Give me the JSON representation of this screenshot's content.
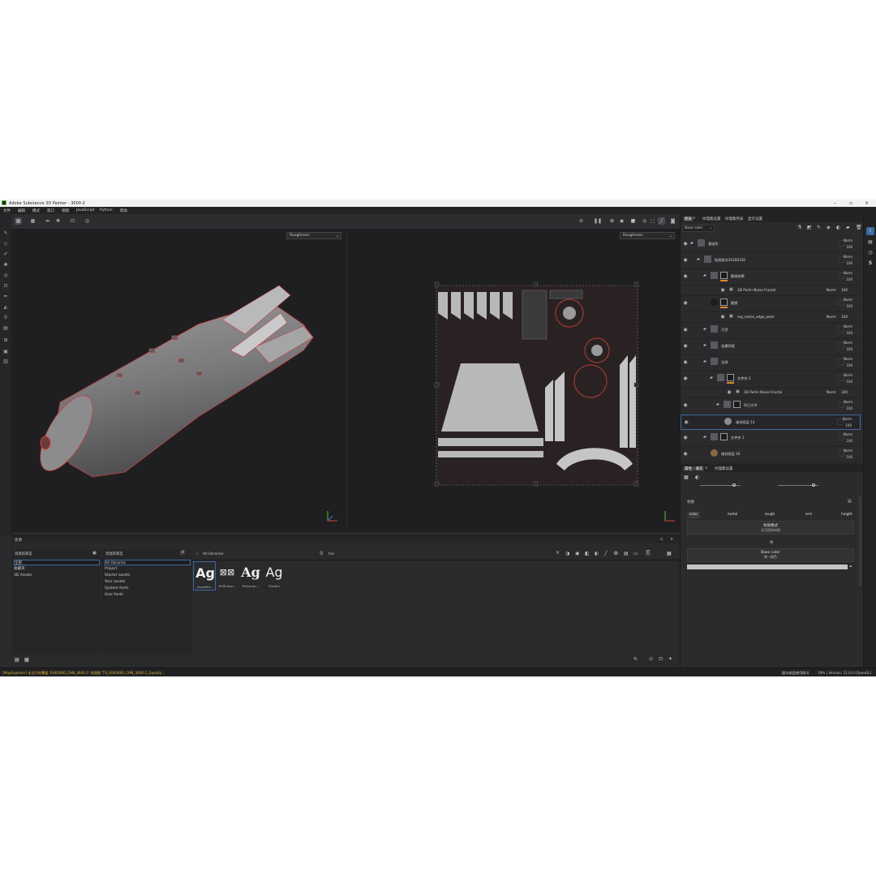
{
  "window": {
    "title": "Adobe Substance 3D Painter - 3000-2"
  },
  "menu": [
    "文件",
    "编辑",
    "模式",
    "窗口",
    "视图",
    "JavaScript",
    "Python",
    "帮助"
  ],
  "viewport_3d": {
    "channel": "Roughness"
  },
  "viewport_2d": {
    "channel": "Roughness"
  },
  "layers_panel": {
    "tabs": [
      "图层",
      "纹理集设置",
      "纹理集列表",
      "显示设置"
    ],
    "channel_select": "Base color",
    "layers": [
      {
        "name": "基础色",
        "blend": "Norm",
        "opacity": "100",
        "type": "folder"
      },
      {
        "name": "贴图组合20200330",
        "blend": "Norm",
        "opacity": "100",
        "type": "folder"
      },
      {
        "name": "磨损效果",
        "blend": "Norm",
        "opacity": "100",
        "type": "folder-mask"
      },
      {
        "name": "3D Perlin Noise Fractal",
        "blend": "Norm",
        "opacity": "100",
        "type": "effect"
      },
      {
        "name": "磨损",
        "blend": "Norm",
        "opacity": "100",
        "type": "fill-mask"
      },
      {
        "name": "mg_metal_edge_wear",
        "blend": "Norm",
        "opacity": "100",
        "type": "effect"
      },
      {
        "name": "污渍",
        "blend": "Norm",
        "opacity": "100",
        "type": "folder"
      },
      {
        "name": "金属划痕",
        "blend": "Norm",
        "opacity": "100",
        "type": "folder"
      },
      {
        "name": "法线",
        "blend": "Norm",
        "opacity": "100",
        "type": "folder"
      },
      {
        "name": "文件夹 2",
        "blend": "Norm",
        "opacity": "100",
        "type": "folder-mask"
      },
      {
        "name": "3D Perlin Noise Fractal",
        "blend": "Norm",
        "opacity": "100",
        "type": "effect"
      },
      {
        "name": "凹凸文字",
        "blend": "Norm",
        "opacity": "100",
        "type": "folder-mask"
      },
      {
        "name": "填充图层 14",
        "blend": "Norm",
        "opacity": "100",
        "type": "fill",
        "selected": true
      },
      {
        "name": "文件夹 1",
        "blend": "Norm",
        "opacity": "100",
        "type": "folder-mask"
      },
      {
        "name": "填充图层 16",
        "blend": "Norm",
        "opacity": "100",
        "type": "fill"
      }
    ]
  },
  "properties_panel": {
    "tabs": [
      "属性 - 填充",
      "纹理集设置"
    ],
    "section": "材质",
    "channels": [
      "color",
      "metal",
      "rough",
      "nrm",
      "height"
    ],
    "material_mode": {
      "title": "材质模式",
      "subtitle": "无可用的材质"
    },
    "section2": "纹",
    "base_color": {
      "title": "Base color",
      "subtitle": "统一颜色"
    }
  },
  "shelf": {
    "title": "资源",
    "col1_header": "资源的筛选",
    "col1_items": [
      "全部",
      "收藏夹",
      "3D Assets"
    ],
    "col2_header": "资源库筛选",
    "col2_items": [
      "All libraries",
      "Project",
      "Starter assets",
      "Your assets",
      "System fonts",
      "User fonts"
    ],
    "breadcrumb": "All libraries",
    "search": "hei",
    "assets": [
      {
        "glyph": "Ag",
        "name": "CloudHei..."
      },
      {
        "glyph": "⊠⊠",
        "name": "HYZhong..."
      },
      {
        "glyph": "Ag",
        "name": "Prosuran..."
      },
      {
        "glyph": "Ag",
        "name": "SimHei"
      }
    ]
  },
  "status": {
    "left": "[MapExporter] 无法写的覆盖 'EA83000_CHN_3000-2' 纹理图 'TX_EA83000_CHN_3000-2_Opacity'。",
    "cache": "缓存磁盘使用情况",
    "version": "19% | Version: 11.0.0 (OpenGL)"
  },
  "colors": {
    "accent": "#3f6aa3",
    "wear_orange": "#e08a2b",
    "edge_red": "#c0413b"
  }
}
